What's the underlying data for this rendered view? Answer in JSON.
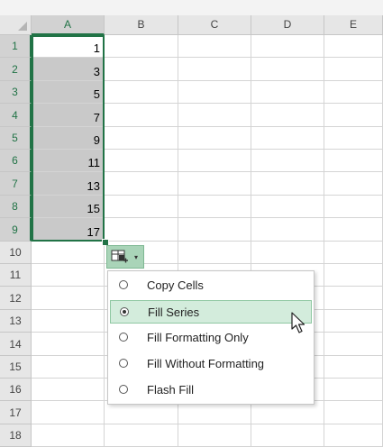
{
  "columns": [
    "A",
    "B",
    "C",
    "D",
    "E"
  ],
  "rows": [
    "1",
    "2",
    "3",
    "4",
    "5",
    "6",
    "7",
    "8",
    "9",
    "10",
    "11",
    "12",
    "13",
    "14",
    "15",
    "16",
    "17",
    "18"
  ],
  "column_a_values": [
    "1",
    "3",
    "5",
    "7",
    "9",
    "11",
    "13",
    "15",
    "17"
  ],
  "autofill_options": {
    "button_icon": "autofill-options-icon",
    "dropdown_icon": "▾",
    "items": [
      {
        "label": "Copy Cells",
        "selected": false
      },
      {
        "label": "Fill Series",
        "selected": true
      },
      {
        "label": "Fill Formatting Only",
        "selected": false
      },
      {
        "label": "Fill Without Formatting",
        "selected": false
      },
      {
        "label": "Flash Fill",
        "selected": false
      }
    ]
  },
  "colors": {
    "selection_border": "#217346",
    "selected_fill": "#c9c9c9",
    "menu_highlight": "#d3ecdc"
  }
}
